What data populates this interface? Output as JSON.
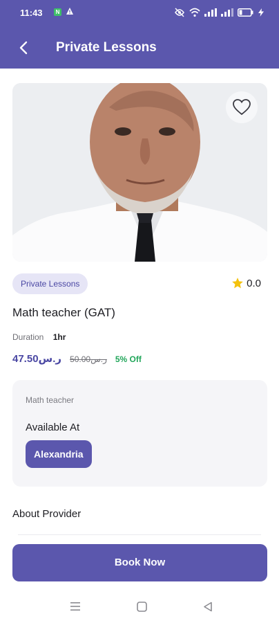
{
  "status_bar": {
    "time": "11:43",
    "badge": "N"
  },
  "header": {
    "title": "Private Lessons"
  },
  "service": {
    "category": "Private Lessons",
    "rating": "0.0",
    "title": "Math teacher (GAT)",
    "duration_label": "Duration",
    "duration_value": "1hr",
    "price": "47.50ر.س",
    "old_price": "50.00ر.س",
    "discount": "5% Off"
  },
  "provider_card": {
    "label": "Math teacher",
    "available_label": "Available At",
    "location": "Alexandria"
  },
  "about": {
    "label": "About Provider"
  },
  "actions": {
    "book_label": "Book Now"
  },
  "colors": {
    "primary": "#5b57ad",
    "chip_bg": "#e6e5f6",
    "discount": "#21a65a",
    "star": "#f4c20d"
  },
  "icons": [
    "back-arrow-icon",
    "heart-icon",
    "star-icon",
    "wifi-icon",
    "signal-icon",
    "battery-icon",
    "menu-icon",
    "home-icon",
    "back-triangle-icon"
  ]
}
